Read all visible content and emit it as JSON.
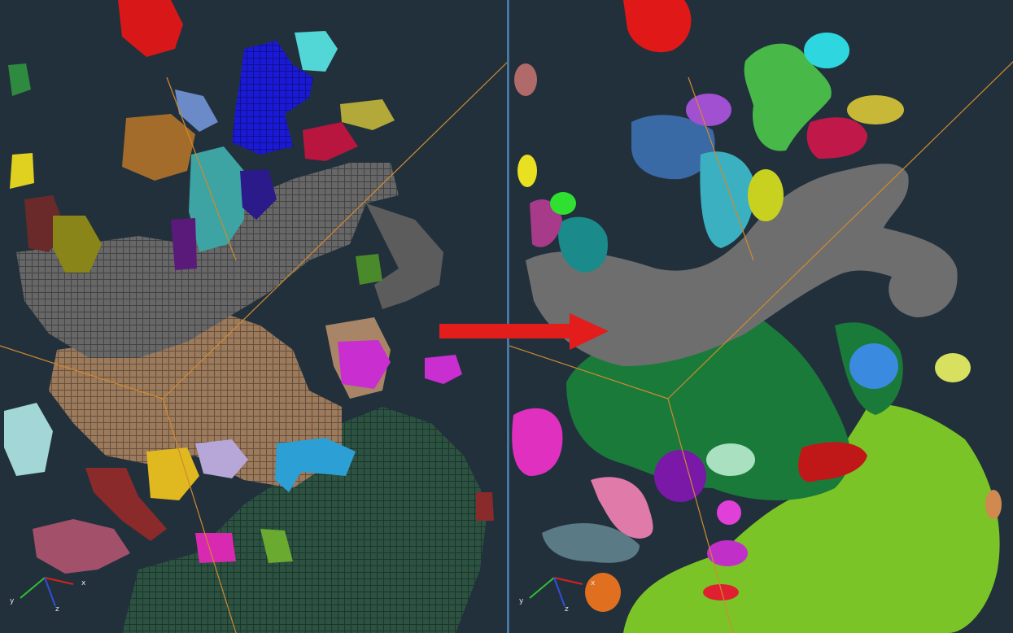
{
  "views": {
    "left": {
      "kind": "voxel segmentation",
      "axes": {
        "x": "x",
        "y": "y",
        "z": "z"
      }
    },
    "right": {
      "kind": "smoothed surface segmentation",
      "axes": {
        "x": "x",
        "y": "y",
        "z": "z"
      }
    }
  },
  "arrow": {
    "color": "#e31c1c"
  },
  "colors": {
    "background": "#22303c",
    "bounding_box": "#d08a2e",
    "panel_border": "#4a7aa8"
  }
}
